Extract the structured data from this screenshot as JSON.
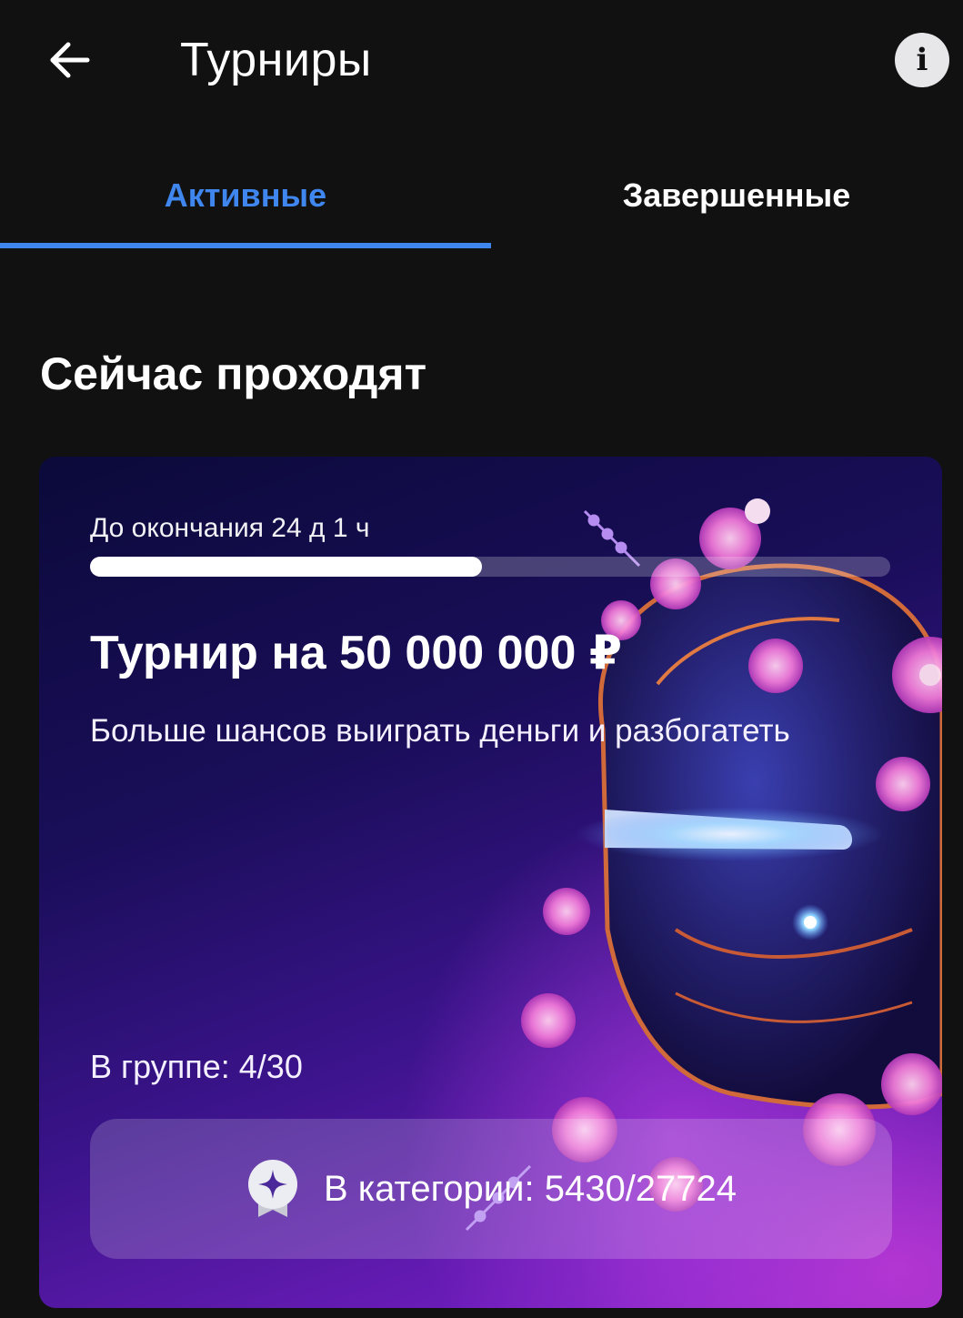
{
  "header": {
    "title": "Турниры",
    "back_icon": "arrow-left-icon",
    "info_icon": "info-icon"
  },
  "tabs": [
    {
      "label": "Активные",
      "active": true
    },
    {
      "label": "Завершенные",
      "active": false
    }
  ],
  "section": {
    "title": "Сейчас проходят"
  },
  "tournament": {
    "timer": "До окончания 24 д 1 ч",
    "progress": 0.49,
    "title": "Турнир на 50 000 000 ₽",
    "subtitle": "Больше шансов выиграть деньги и разбогатеть",
    "group": "В группе: 4/30",
    "category": "В категории: 5430/27724",
    "category_icon": "star-badge-icon"
  },
  "colors": {
    "background": "#111112",
    "accent": "#3f86ef",
    "text": "#ffffff"
  }
}
